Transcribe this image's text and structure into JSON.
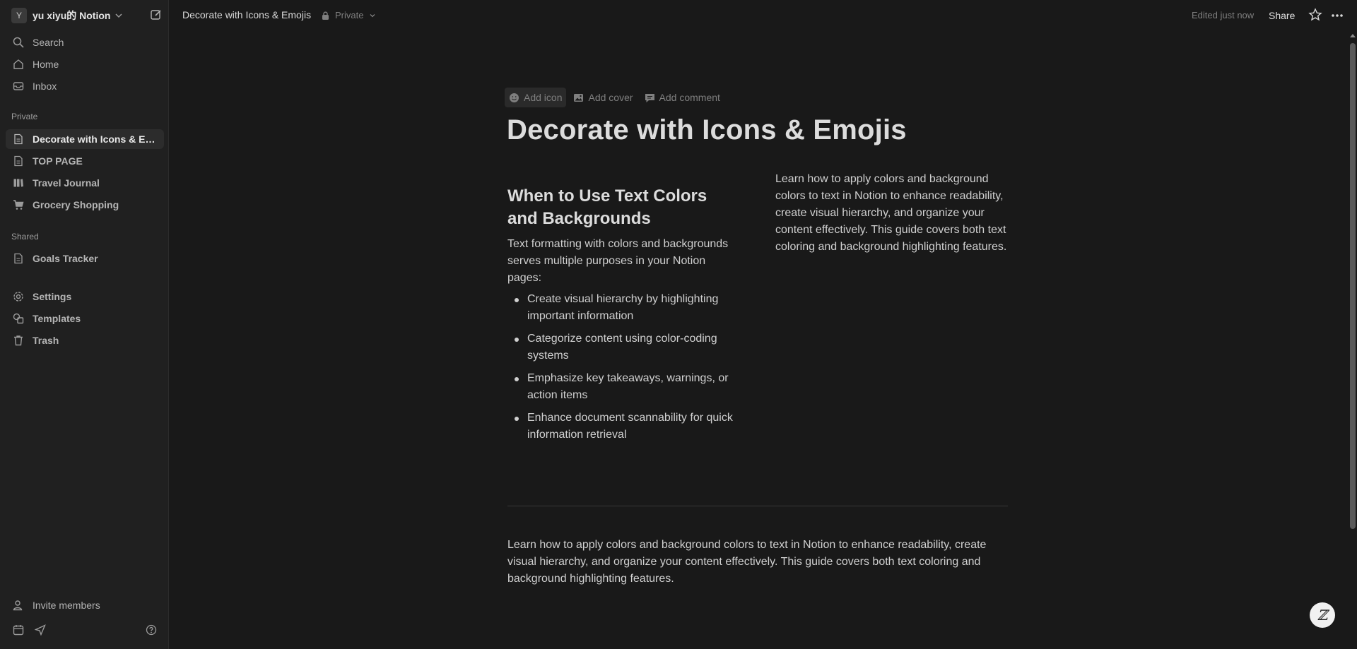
{
  "sidebar": {
    "workspace": {
      "avatar": "Y",
      "name": "yu xiyu的 Notion"
    },
    "top_items": [
      {
        "label": "Search",
        "icon": "search-icon"
      },
      {
        "label": "Home",
        "icon": "home-icon"
      },
      {
        "label": "Inbox",
        "icon": "inbox-icon"
      }
    ],
    "private_label": "Private",
    "private_items": [
      {
        "label": "Decorate with Icons & Emojis",
        "icon": "page-icon",
        "active": true
      },
      {
        "label": "TOP PAGE",
        "icon": "page-icon"
      },
      {
        "label": "Travel Journal",
        "icon": "book-icon"
      },
      {
        "label": "Grocery Shopping",
        "icon": "cart-icon"
      }
    ],
    "shared_label": "Shared",
    "shared_items": [
      {
        "label": "Goals Tracker",
        "icon": "page-icon"
      }
    ],
    "utility_items": [
      {
        "label": "Settings",
        "icon": "gear-icon"
      },
      {
        "label": "Templates",
        "icon": "templates-icon"
      },
      {
        "label": "Trash",
        "icon": "trash-icon"
      }
    ],
    "invite_label": "Invite members"
  },
  "topbar": {
    "breadcrumb": "Decorate with Icons & Emojis",
    "privacy": "Private",
    "edited": "Edited just now",
    "share": "Share"
  },
  "page": {
    "actions": {
      "add_icon": "Add icon",
      "add_cover": "Add cover",
      "add_comment": "Add comment"
    },
    "title": "Decorate with Icons & Emojis",
    "left_heading": "When to Use Text Colors and Backgrounds",
    "left_intro": "Text formatting with colors and backgrounds serves multiple purposes in your Notion pages:",
    "bullets": [
      "Create visual hierarchy by highlighting important information",
      "Categorize content using color-coding systems",
      "Emphasize key takeaways, warnings, or action items",
      "Enhance document scannability for quick information retrieval"
    ],
    "right_text": "Learn how to apply colors and background colors to text in Notion to enhance readability, create visual hierarchy, and organize your content effectively. This guide covers both text coloring and background highlighting features.",
    "bottom_text": "Learn how to apply colors and background colors to text in Notion to enhance readability, create visual hierarchy, and organize your content effectively. This guide covers both text coloring and background highlighting features."
  },
  "help_fab": "ℤ"
}
